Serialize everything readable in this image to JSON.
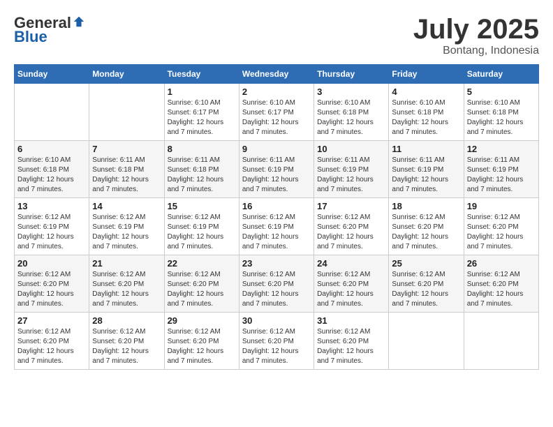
{
  "header": {
    "logo_general": "General",
    "logo_blue": "Blue",
    "month": "July 2025",
    "location": "Bontang, Indonesia"
  },
  "weekdays": [
    "Sunday",
    "Monday",
    "Tuesday",
    "Wednesday",
    "Thursday",
    "Friday",
    "Saturday"
  ],
  "rows": [
    [
      {
        "day": "",
        "info": ""
      },
      {
        "day": "",
        "info": ""
      },
      {
        "day": "1",
        "info": "Sunrise: 6:10 AM\nSunset: 6:17 PM\nDaylight: 12 hours and 7 minutes."
      },
      {
        "day": "2",
        "info": "Sunrise: 6:10 AM\nSunset: 6:17 PM\nDaylight: 12 hours and 7 minutes."
      },
      {
        "day": "3",
        "info": "Sunrise: 6:10 AM\nSunset: 6:18 PM\nDaylight: 12 hours and 7 minutes."
      },
      {
        "day": "4",
        "info": "Sunrise: 6:10 AM\nSunset: 6:18 PM\nDaylight: 12 hours and 7 minutes."
      },
      {
        "day": "5",
        "info": "Sunrise: 6:10 AM\nSunset: 6:18 PM\nDaylight: 12 hours and 7 minutes."
      }
    ],
    [
      {
        "day": "6",
        "info": "Sunrise: 6:10 AM\nSunset: 6:18 PM\nDaylight: 12 hours and 7 minutes."
      },
      {
        "day": "7",
        "info": "Sunrise: 6:11 AM\nSunset: 6:18 PM\nDaylight: 12 hours and 7 minutes."
      },
      {
        "day": "8",
        "info": "Sunrise: 6:11 AM\nSunset: 6:18 PM\nDaylight: 12 hours and 7 minutes."
      },
      {
        "day": "9",
        "info": "Sunrise: 6:11 AM\nSunset: 6:19 PM\nDaylight: 12 hours and 7 minutes."
      },
      {
        "day": "10",
        "info": "Sunrise: 6:11 AM\nSunset: 6:19 PM\nDaylight: 12 hours and 7 minutes."
      },
      {
        "day": "11",
        "info": "Sunrise: 6:11 AM\nSunset: 6:19 PM\nDaylight: 12 hours and 7 minutes."
      },
      {
        "day": "12",
        "info": "Sunrise: 6:11 AM\nSunset: 6:19 PM\nDaylight: 12 hours and 7 minutes."
      }
    ],
    [
      {
        "day": "13",
        "info": "Sunrise: 6:12 AM\nSunset: 6:19 PM\nDaylight: 12 hours and 7 minutes."
      },
      {
        "day": "14",
        "info": "Sunrise: 6:12 AM\nSunset: 6:19 PM\nDaylight: 12 hours and 7 minutes."
      },
      {
        "day": "15",
        "info": "Sunrise: 6:12 AM\nSunset: 6:19 PM\nDaylight: 12 hours and 7 minutes."
      },
      {
        "day": "16",
        "info": "Sunrise: 6:12 AM\nSunset: 6:19 PM\nDaylight: 12 hours and 7 minutes."
      },
      {
        "day": "17",
        "info": "Sunrise: 6:12 AM\nSunset: 6:20 PM\nDaylight: 12 hours and 7 minutes."
      },
      {
        "day": "18",
        "info": "Sunrise: 6:12 AM\nSunset: 6:20 PM\nDaylight: 12 hours and 7 minutes."
      },
      {
        "day": "19",
        "info": "Sunrise: 6:12 AM\nSunset: 6:20 PM\nDaylight: 12 hours and 7 minutes."
      }
    ],
    [
      {
        "day": "20",
        "info": "Sunrise: 6:12 AM\nSunset: 6:20 PM\nDaylight: 12 hours and 7 minutes."
      },
      {
        "day": "21",
        "info": "Sunrise: 6:12 AM\nSunset: 6:20 PM\nDaylight: 12 hours and 7 minutes."
      },
      {
        "day": "22",
        "info": "Sunrise: 6:12 AM\nSunset: 6:20 PM\nDaylight: 12 hours and 7 minutes."
      },
      {
        "day": "23",
        "info": "Sunrise: 6:12 AM\nSunset: 6:20 PM\nDaylight: 12 hours and 7 minutes."
      },
      {
        "day": "24",
        "info": "Sunrise: 6:12 AM\nSunset: 6:20 PM\nDaylight: 12 hours and 7 minutes."
      },
      {
        "day": "25",
        "info": "Sunrise: 6:12 AM\nSunset: 6:20 PM\nDaylight: 12 hours and 7 minutes."
      },
      {
        "day": "26",
        "info": "Sunrise: 6:12 AM\nSunset: 6:20 PM\nDaylight: 12 hours and 7 minutes."
      }
    ],
    [
      {
        "day": "27",
        "info": "Sunrise: 6:12 AM\nSunset: 6:20 PM\nDaylight: 12 hours and 7 minutes."
      },
      {
        "day": "28",
        "info": "Sunrise: 6:12 AM\nSunset: 6:20 PM\nDaylight: 12 hours and 7 minutes."
      },
      {
        "day": "29",
        "info": "Sunrise: 6:12 AM\nSunset: 6:20 PM\nDaylight: 12 hours and 7 minutes."
      },
      {
        "day": "30",
        "info": "Sunrise: 6:12 AM\nSunset: 6:20 PM\nDaylight: 12 hours and 7 minutes."
      },
      {
        "day": "31",
        "info": "Sunrise: 6:12 AM\nSunset: 6:20 PM\nDaylight: 12 hours and 7 minutes."
      },
      {
        "day": "",
        "info": ""
      },
      {
        "day": "",
        "info": ""
      }
    ]
  ]
}
